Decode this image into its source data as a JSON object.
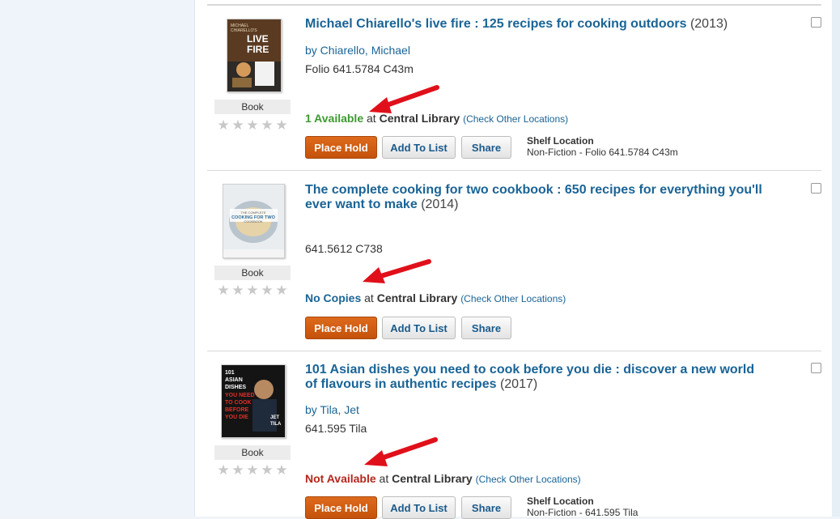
{
  "results": [
    {
      "title": "Michael Chiarello's live fire : 125 recipes for cooking outdoors",
      "year": "(2013)",
      "author": "by Chiarello, Michael",
      "call_number": "Folio 641.5784 C43m",
      "format": "Book",
      "status": "1 Available",
      "at": "at",
      "library": "Central Library",
      "other_locations": "(Check Other Locations)",
      "shelf_location_label": "Shelf Location",
      "shelf_location_value": "Non-Fiction - Folio 641.5784 C43m",
      "cover_text": [
        "MICHAEL",
        "CHIARELLO'S",
        "LIVE",
        "FIRE"
      ]
    },
    {
      "title": "The complete cooking for two cookbook : 650 recipes for everything you'll ever want to make",
      "year": "(2014)",
      "call_number": "641.5612 C738",
      "format": "Book",
      "status": "No Copies",
      "at": "at",
      "library": "Central Library",
      "other_locations": "(Check Other Locations)",
      "cover_text": [
        "THE COMPLETE",
        "COOKING FOR TWO",
        "COOKBOOK"
      ]
    },
    {
      "title": "101 Asian dishes you need to cook before you die : discover a new world of flavours in authentic recipes",
      "year": "(2017)",
      "author": "by Tila, Jet",
      "call_number": "641.595 Tila",
      "format": "Book",
      "status": "Not Available",
      "at": "at",
      "library": "Central Library",
      "other_locations": "(Check Other Locations)",
      "shelf_location_label": "Shelf Location",
      "shelf_location_value": "Non-Fiction - 641.595 Tila",
      "cover_text": [
        "101",
        "ASIAN",
        "DISHES",
        "YOU NEED",
        "TO COOK",
        "BEFORE",
        "YOU DIE",
        "JET",
        "TILA"
      ]
    }
  ],
  "buttons": {
    "place_hold": "Place Hold",
    "add_to_list": "Add To List",
    "share": "Share"
  },
  "stars": [
    "★",
    "★",
    "★",
    "★",
    "★"
  ],
  "rating": 0,
  "colors": {
    "link": "#1a6496",
    "available": "#3c9a2f",
    "no_copies": "#1a6496",
    "not_available": "#b5271c",
    "place_hold": "#d0600f",
    "annotation_arrow": "#e0101a"
  },
  "icons": [
    "checkbox",
    "star-icon",
    "red-arrow-annotation"
  ]
}
